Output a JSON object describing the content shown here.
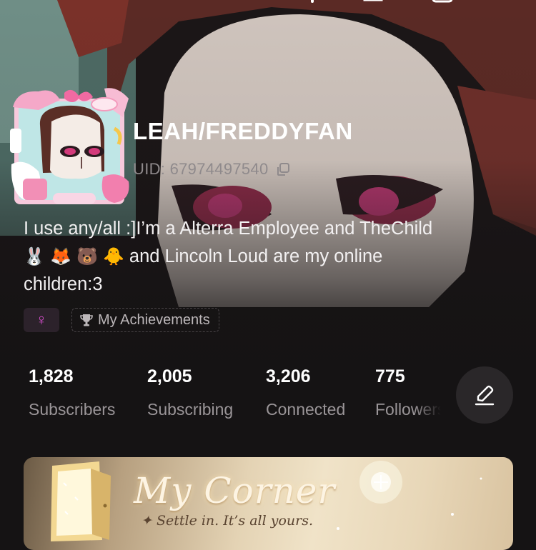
{
  "profile": {
    "username": "LEAH/FREDDYFAN",
    "uid": "UID: 67974497540",
    "bio_line1": "I use any/all :]I’m a Alterra Employee and TheChild",
    "bio_emojis": [
      "🐰",
      "🦊",
      "🐻",
      "🐥"
    ],
    "bio_line2": " and Lincoln Loud are my online",
    "bio_line3": "children:3",
    "gender_symbol": "♀",
    "achievements_label": "My Achievements"
  },
  "stats": [
    {
      "value": "1,828",
      "label": "Subscribers"
    },
    {
      "value": "2,005",
      "label": "Subscribing"
    },
    {
      "value": "3,206",
      "label": "Connected"
    },
    {
      "value": "775",
      "label": "Followers"
    }
  ],
  "banner": {
    "title": "My Corner",
    "subtitle": "✦ Settle in. It’s all yours."
  },
  "icons": {
    "copy": "copy-icon",
    "edit": "edit-pencil-icon",
    "trophy": "trophy-icon",
    "gender": "female-symbol-icon"
  },
  "colors": {
    "background": "#151314",
    "uid_text": "#8f8a8c",
    "gender_accent": "#d94fd0",
    "stat_label": "#9a9598",
    "edit_button": "#2a2729"
  }
}
